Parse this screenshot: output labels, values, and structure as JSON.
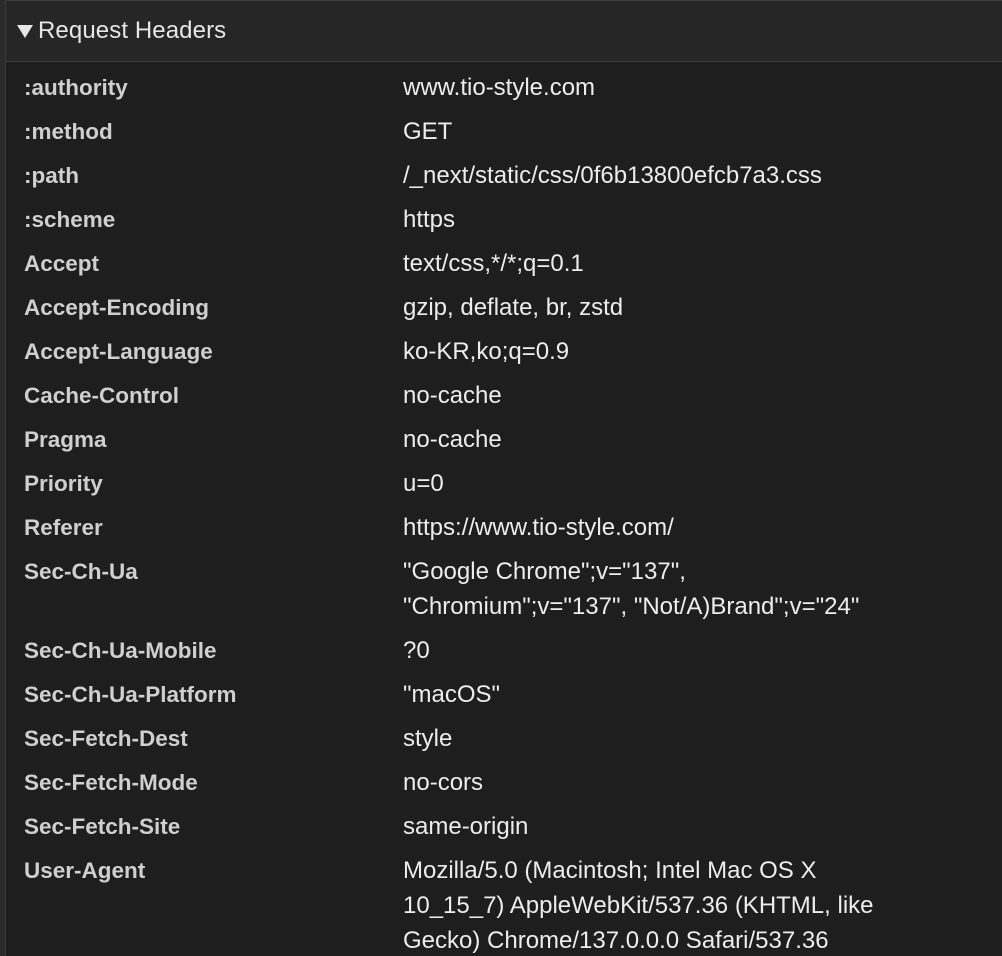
{
  "section": {
    "title": "Request Headers"
  },
  "headers": [
    {
      "name": ":authority",
      "lines": [
        "www.tio-style.com"
      ]
    },
    {
      "name": ":method",
      "lines": [
        "GET"
      ]
    },
    {
      "name": ":path",
      "lines": [
        "/_next/static/css/0f6b13800efcb7a3.css"
      ]
    },
    {
      "name": ":scheme",
      "lines": [
        "https"
      ]
    },
    {
      "name": "Accept",
      "lines": [
        "text/css,*/*;q=0.1"
      ]
    },
    {
      "name": "Accept-Encoding",
      "lines": [
        "gzip, deflate, br, zstd"
      ]
    },
    {
      "name": "Accept-Language",
      "lines": [
        "ko-KR,ko;q=0.9"
      ]
    },
    {
      "name": "Cache-Control",
      "lines": [
        "no-cache"
      ]
    },
    {
      "name": "Pragma",
      "lines": [
        "no-cache"
      ]
    },
    {
      "name": "Priority",
      "lines": [
        "u=0"
      ]
    },
    {
      "name": "Referer",
      "lines": [
        "https://www.tio-style.com/"
      ]
    },
    {
      "name": "Sec-Ch-Ua",
      "lines": [
        "\"Google Chrome\";v=\"137\",",
        "\"Chromium\";v=\"137\", \"Not/A)Brand\";v=\"24\""
      ]
    },
    {
      "name": "Sec-Ch-Ua-Mobile",
      "lines": [
        "?0"
      ]
    },
    {
      "name": "Sec-Ch-Ua-Platform",
      "lines": [
        "\"macOS\""
      ]
    },
    {
      "name": "Sec-Fetch-Dest",
      "lines": [
        "style"
      ]
    },
    {
      "name": "Sec-Fetch-Mode",
      "lines": [
        "no-cors"
      ]
    },
    {
      "name": "Sec-Fetch-Site",
      "lines": [
        "same-origin"
      ]
    },
    {
      "name": "User-Agent",
      "lines": [
        "Mozilla/5.0 (Macintosh; Intel Mac OS X",
        "10_15_7) AppleWebKit/537.36 (KHTML, like",
        "Gecko) Chrome/137.0.0.0 Safari/537.36"
      ]
    }
  ],
  "icons": {
    "toggle": "triangle-down-icon"
  },
  "colors": {
    "background": "#1e1e1e",
    "header_background": "#262626",
    "name_text": "#cfcfcf",
    "value_text": "#ececec"
  }
}
